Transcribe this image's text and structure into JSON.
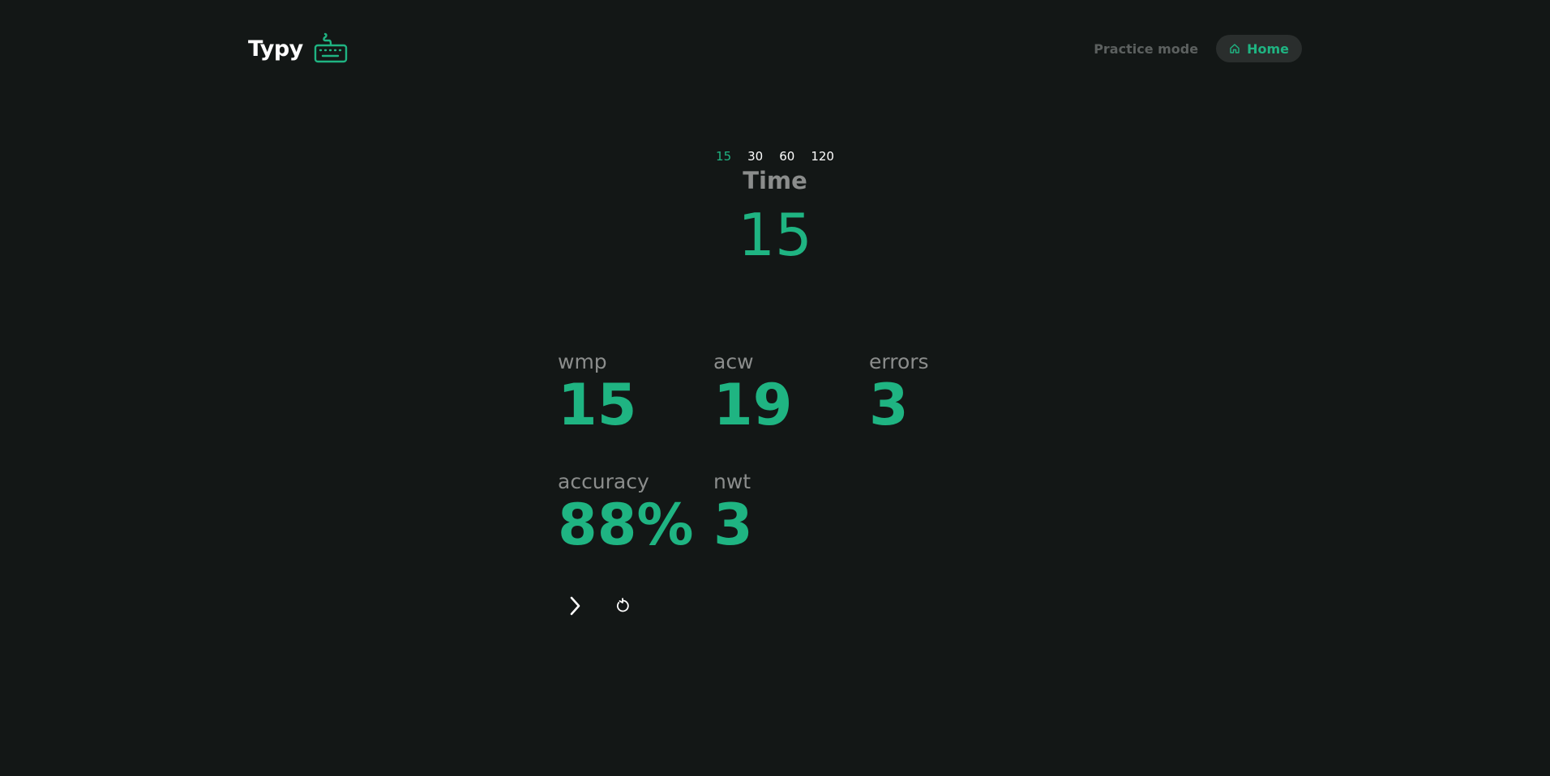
{
  "header": {
    "brand_name": "Typy",
    "brand_icon": "keyboard-icon",
    "nav": {
      "practice_label": "Practice mode",
      "home_label": "Home",
      "home_icon": "home-icon"
    }
  },
  "timer": {
    "options": [
      "15",
      "30",
      "60",
      "120"
    ],
    "selected": "15",
    "label": "Time",
    "value": "15"
  },
  "stats": {
    "wmp": {
      "label": "wmp",
      "value": "15"
    },
    "acw": {
      "label": "acw",
      "value": "19"
    },
    "errors": {
      "label": "errors",
      "value": "3"
    },
    "accuracy": {
      "label": "accuracy",
      "value": "88%"
    },
    "nwt": {
      "label": "nwt",
      "value": "3"
    }
  },
  "actions": {
    "next_icon": "chevron-right-icon",
    "restart_icon": "restart-icon"
  },
  "colors": {
    "background": "#131716",
    "accent": "#1fb482",
    "muted": "#8b8d8c",
    "nav_muted": "#5c605f",
    "pill_bg": "#2a2e2d"
  }
}
